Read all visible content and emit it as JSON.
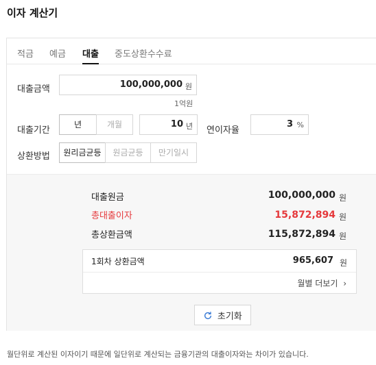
{
  "header": {
    "title": "이자 계산기"
  },
  "tabs": [
    {
      "label": "적금"
    },
    {
      "label": "예금"
    },
    {
      "label": "대출"
    },
    {
      "label": "중도상환수수료"
    }
  ],
  "form": {
    "amount_label": "대출금액",
    "amount_value": "100,000,000",
    "amount_unit": "원",
    "amount_hint": "1억원",
    "period_label": "대출기간",
    "period_year": "년",
    "period_month": "개월",
    "period_value": "10",
    "period_unit": "년",
    "rate_label": "연이자율",
    "rate_value": "3",
    "rate_unit": "%",
    "method_label": "상환방법",
    "methods": [
      {
        "label": "원리금균등"
      },
      {
        "label": "원금균등"
      },
      {
        "label": "만기일시"
      }
    ]
  },
  "result": {
    "principal_label": "대출원금",
    "principal_value": "100,000,000",
    "interest_label": "총대출이자",
    "interest_value": "15,872,894",
    "total_label": "총상환금액",
    "total_value": "115,872,894",
    "unit": "원",
    "first_label": "1회차 상환금액",
    "first_value": "965,607",
    "monthly_more": "월별 더보기",
    "reset_label": "초기화",
    "accent_red": "#e5383b"
  },
  "footer": {
    "note": "월단위로 계산된 이자이기 때문에 일단위로 계산되는 금융기관의 대출이자와는 차이가 있습니다."
  }
}
